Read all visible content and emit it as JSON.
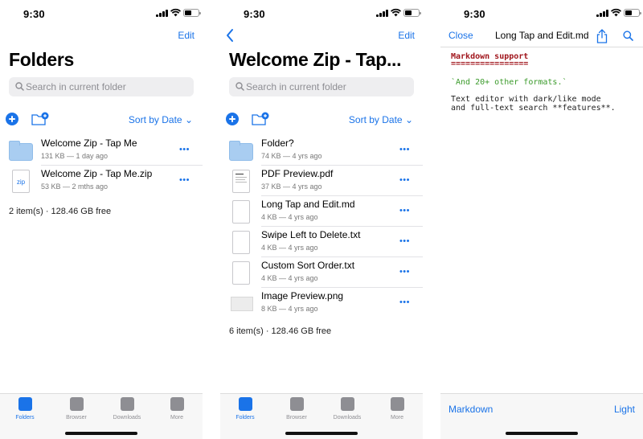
{
  "colors": {
    "accent": "#1a73e8",
    "folder": "#a9cdf1",
    "md_heading": "#a0151c",
    "md_code": "#3a9a2a"
  },
  "status": {
    "time": "9:30"
  },
  "screen1": {
    "edit_label": "Edit",
    "title": "Folders",
    "search_placeholder": "Search in current folder",
    "sort_label": "Sort by Date",
    "items": [
      {
        "name": "Welcome Zip - Tap Me",
        "meta": "131 KB — 1 day ago",
        "kind": "folder"
      },
      {
        "name": "Welcome Zip - Tap Me.zip",
        "meta": "53 KB — 2 mths ago",
        "kind": "zip",
        "thumb_label": "zip"
      }
    ],
    "footer": "2 item(s) · 128.46 GB free"
  },
  "screen2": {
    "edit_label": "Edit",
    "title": "Welcome Zip - Tap...",
    "search_placeholder": "Search in current folder",
    "sort_label": "Sort by Date",
    "items": [
      {
        "name": "Folder?",
        "meta": "74 KB — 4 yrs ago",
        "kind": "folder"
      },
      {
        "name": "PDF Preview.pdf",
        "meta": "37 KB — 4 yrs ago",
        "kind": "pdf"
      },
      {
        "name": "Long Tap and Edit.md",
        "meta": "4 KB — 4 yrs ago",
        "kind": "doc"
      },
      {
        "name": "Swipe Left to Delete.txt",
        "meta": "4 KB — 4 yrs ago",
        "kind": "doc"
      },
      {
        "name": "Custom Sort Order.txt",
        "meta": "4 KB — 4 yrs ago",
        "kind": "doc"
      },
      {
        "name": "Image Preview.png",
        "meta": "8 KB — 4 yrs ago",
        "kind": "image"
      }
    ],
    "footer": "6 item(s) · 128.46 GB free"
  },
  "screen3": {
    "close_label": "Close",
    "title": "Long Tap and Edit.md",
    "lines": [
      {
        "text": "Markdown support",
        "style": "h"
      },
      {
        "text": "================",
        "style": "h"
      },
      {
        "text": "`And 20+ other formats.`",
        "style": "g"
      },
      {
        "text": "Text editor with dark/like mode",
        "style": "t"
      },
      {
        "text": "and full-text search **features**.",
        "style": "t"
      }
    ],
    "bottom_left": "Markdown",
    "bottom_right": "Light"
  },
  "tabs": [
    {
      "label": "Folders",
      "icon": "folders-icon",
      "active": true
    },
    {
      "label": "Browser",
      "icon": "compass-icon",
      "active": false
    },
    {
      "label": "Downloads",
      "icon": "download-icon",
      "active": false
    },
    {
      "label": "More",
      "icon": "more-icon",
      "active": false
    }
  ]
}
